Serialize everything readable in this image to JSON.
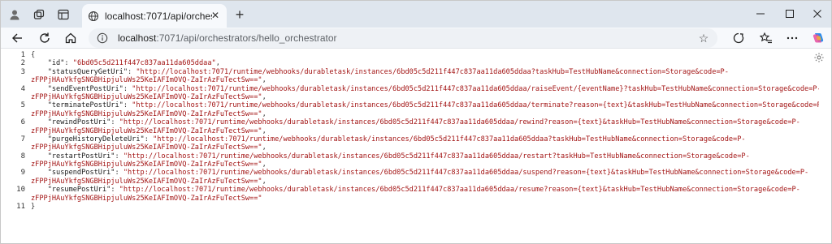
{
  "tab": {
    "title": "localhost:7071/api/orchestrators/"
  },
  "toolbar": {
    "url_host": "localhost",
    "url_rest": ":7071/api/orchestrators/hello_orchestrator"
  },
  "line_numbers": [
    "1",
    "2",
    "3",
    "4",
    "5",
    "6",
    "7",
    "8",
    "9",
    "10",
    "11"
  ],
  "json_lines": [
    {
      "p": "{",
      "k": "",
      "s": "",
      "e": ""
    },
    {
      "p": "    ",
      "k": "\"id\"",
      "s": "\"6bd05c5d211f447c837aa11da605ddaa\"",
      "e": ","
    },
    {
      "p": "    ",
      "k": "\"statusQueryGetUri\"",
      "s": "\"http://localhost:7071/runtime/webhooks/durabletask/instances/6bd05c5d211f447c837aa11da605ddaa?taskHub=TestHubName&connection=Storage&code=P-",
      "e": ""
    },
    {
      "p": "",
      "k": "",
      "s": "zFPPjHAuYkfgSNGBHipjuluWs25KeIAFImOVQ-ZaIrAzFuTectSw==\"",
      "e": ","
    },
    {
      "p": "    ",
      "k": "\"sendEventPostUri\"",
      "s": "\"http://localhost:7071/runtime/webhooks/durabletask/instances/6bd05c5d211f447c837aa11da605ddaa/raiseEvent/{eventName}?taskHub=TestHubName&connection=Storage&code=P-",
      "e": ""
    },
    {
      "p": "",
      "k": "",
      "s": "zFPPjHAuYkfgSNGBHipjuluWs25KeIAFImOVQ-ZaIrAzFuTectSw==\"",
      "e": ","
    },
    {
      "p": "    ",
      "k": "\"terminatePostUri\"",
      "s": "\"http://localhost:7071/runtime/webhooks/durabletask/instances/6bd05c5d211f447c837aa11da605ddaa/terminate?reason={text}&taskHub=TestHubName&connection=Storage&code=P-",
      "e": ""
    },
    {
      "p": "",
      "k": "",
      "s": "zFPPjHAuYkfgSNGBHipjuluWs25KeIAFImOVQ-ZaIrAzFuTectSw==\"",
      "e": ","
    },
    {
      "p": "    ",
      "k": "\"rewindPostUri\"",
      "s": "\"http://localhost:7071/runtime/webhooks/durabletask/instances/6bd05c5d211f447c837aa11da605ddaa/rewind?reason={text}&taskHub=TestHubName&connection=Storage&code=P-",
      "e": ""
    },
    {
      "p": "",
      "k": "",
      "s": "zFPPjHAuYkfgSNGBHipjuluWs25KeIAFImOVQ-ZaIrAzFuTectSw==\"",
      "e": ","
    },
    {
      "p": "    ",
      "k": "\"purgeHistoryDeleteUri\"",
      "s": "\"http://localhost:7071/runtime/webhooks/durabletask/instances/6bd05c5d211f447c837aa11da605ddaa?taskHub=TestHubName&connection=Storage&code=P-",
      "e": ""
    },
    {
      "p": "",
      "k": "",
      "s": "zFPPjHAuYkfgSNGBHipjuluWs25KeIAFImOVQ-ZaIrAzFuTectSw==\"",
      "e": ","
    },
    {
      "p": "    ",
      "k": "\"restartPostUri\"",
      "s": "\"http://localhost:7071/runtime/webhooks/durabletask/instances/6bd05c5d211f447c837aa11da605ddaa/restart?taskHub=TestHubName&connection=Storage&code=P-",
      "e": ""
    },
    {
      "p": "",
      "k": "",
      "s": "zFPPjHAuYkfgSNGBHipjuluWs25KeIAFImOVQ-ZaIrAzFuTectSw==\"",
      "e": ","
    },
    {
      "p": "    ",
      "k": "\"suspendPostUri\"",
      "s": "\"http://localhost:7071/runtime/webhooks/durabletask/instances/6bd05c5d211f447c837aa11da605ddaa/suspend?reason={text}&taskHub=TestHubName&connection=Storage&code=P-",
      "e": ""
    },
    {
      "p": "",
      "k": "",
      "s": "zFPPjHAuYkfgSNGBHipjuluWs25KeIAFImOVQ-ZaIrAzFuTectSw==\"",
      "e": ","
    },
    {
      "p": "    ",
      "k": "\"resumePostUri\"",
      "s": "\"http://localhost:7071/runtime/webhooks/durabletask/instances/6bd05c5d211f447c837aa11da605ddaa/resume?reason={text}&taskHub=TestHubName&connection=Storage&code=P-",
      "e": ""
    },
    {
      "p": "",
      "k": "",
      "s": "zFPPjHAuYkfgSNGBHipjuluWs25KeIAFImOVQ-ZaIrAzFuTectSw==\"",
      "e": ""
    },
    {
      "p": "}",
      "k": "",
      "s": "",
      "e": ""
    }
  ],
  "colors": {
    "json_key": "#1a1a1a",
    "json_string": "#a31515",
    "titlebar": "#dfe6ee"
  },
  "icons": {
    "profile": "profile-icon",
    "workspaces": "workspaces-icon",
    "tab_actions": "tab-actions-icon",
    "favicon": "globe-icon",
    "settings": "gear-icon"
  }
}
